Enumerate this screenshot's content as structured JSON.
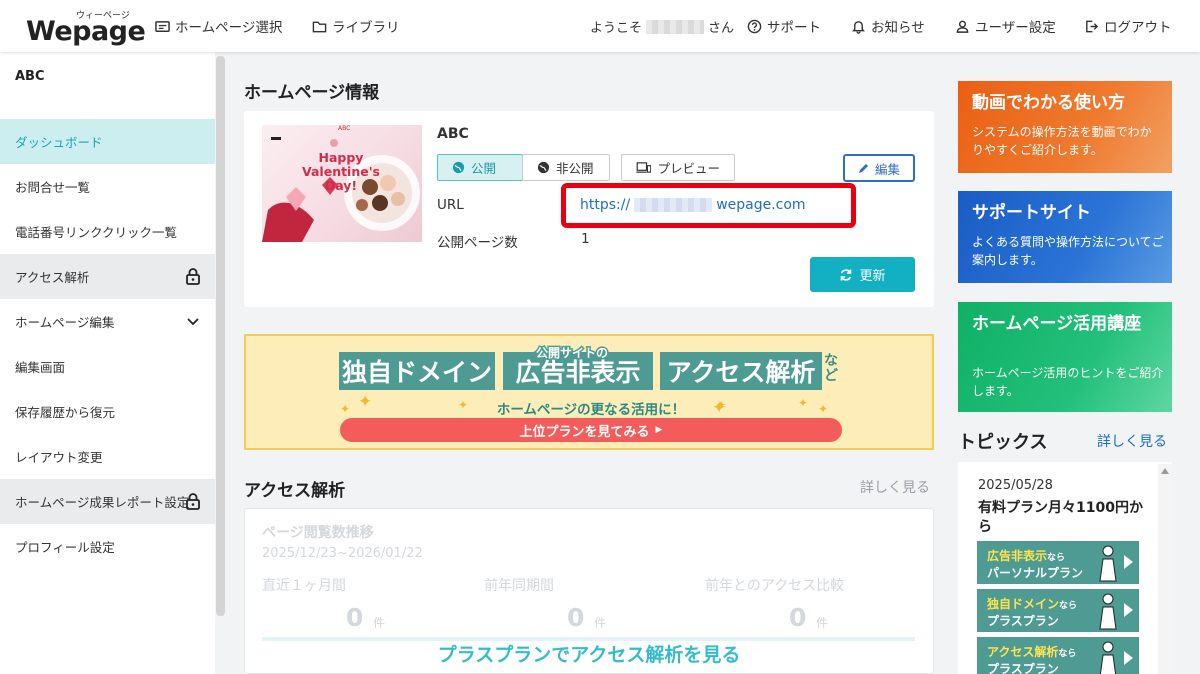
{
  "header": {
    "logo_ruby": "ウィーページ",
    "logo_text": "Wepage",
    "nav": {
      "homepage_select": "ホームページ選択",
      "library": "ライブラリ"
    },
    "welcome_prefix": "ようこそ",
    "welcome_suffix": "さん",
    "support": "サポート",
    "notice": "お知らせ",
    "user_settings": "ユーザー設定",
    "logout": "ログアウト"
  },
  "sidebar": {
    "site_name": "ABC",
    "items": [
      {
        "label": "ダッシュボード",
        "state": "active"
      },
      {
        "label": "お問合せ一覧"
      },
      {
        "label": "電話番号リンククリック一覧"
      },
      {
        "label": "アクセス解析",
        "icon": "lock-icon"
      },
      {
        "label": "ホームページ編集",
        "icon": "chevron-down-icon"
      },
      {
        "label": "編集画面"
      },
      {
        "label": "保存履歴から復元"
      },
      {
        "label": "レイアウト変更"
      },
      {
        "label": "ホームページ成果レポート設定",
        "icon": "lock-icon"
      },
      {
        "label": "プロフィール設定"
      }
    ]
  },
  "homepage_info": {
    "section_title": "ホームページ情報",
    "site_name": "ABC",
    "thumb_logo": "ABC",
    "thumb_text": [
      "Happy",
      "Valentine's",
      "Day!"
    ],
    "toggle_public": "公開",
    "toggle_private": "非公開",
    "preview": "プレビュー",
    "edit": "編集",
    "url_label": "URL",
    "url_prefix": "https://",
    "url_suffix": "wepage.com",
    "pages_label": "公開ページ数",
    "pages_value": "1",
    "update": "更新"
  },
  "promo": {
    "box1": "独自ドメイン",
    "box2_small": "公開サイトの",
    "box2": "広告非表示",
    "box3": "アクセス解析",
    "etc": "など",
    "subtitle": "ホームページの更なる活用に！",
    "button": "上位プランを見てみる"
  },
  "analytics": {
    "section_title": "アクセス解析",
    "more": "詳しく見る",
    "chart_title": "ページ閲覧数推移",
    "period": "2025/12/23~2026/01/22",
    "col1": "直近１ヶ月間",
    "col2": "前年同期間",
    "col3": "前年とのアクセス比較",
    "val1": "0",
    "val2": "0",
    "val3": "0",
    "unit": "件",
    "cta": "プラスプランでアクセス解析を見る"
  },
  "right_cards": [
    {
      "title": "動画でわかる使い方",
      "desc": "システムの操作方法を動画でわかりやすくご紹介します。",
      "color": "#ec6a1c"
    },
    {
      "title": "サポートサイト",
      "desc": "よくある質問や操作方法についてご案内します。",
      "color": "#1f64c8"
    },
    {
      "title": "ホームページ活用講座",
      "desc": "ホームページ活用のヒントをご紹介します。",
      "color": "#13b66e"
    }
  ],
  "topics": {
    "title": "トピックス",
    "more": "詳しく見る",
    "date": "2025/05/28",
    "headline": "有料プラン月々1100円から",
    "banners": [
      {
        "highlight": "広告非表示",
        "small": "なら",
        "plan": "パーソナルプラン"
      },
      {
        "highlight": "独自ドメイン",
        "small": "なら",
        "plan": "プラスプラン"
      },
      {
        "highlight": "アクセス解析",
        "small": "なら",
        "plan": "プラスプラン"
      }
    ]
  },
  "colors": {
    "accent": "#13b0c4",
    "active_bg": "#cdeef0",
    "link": "#1c6ec7",
    "highlight_box": "#e60012"
  }
}
